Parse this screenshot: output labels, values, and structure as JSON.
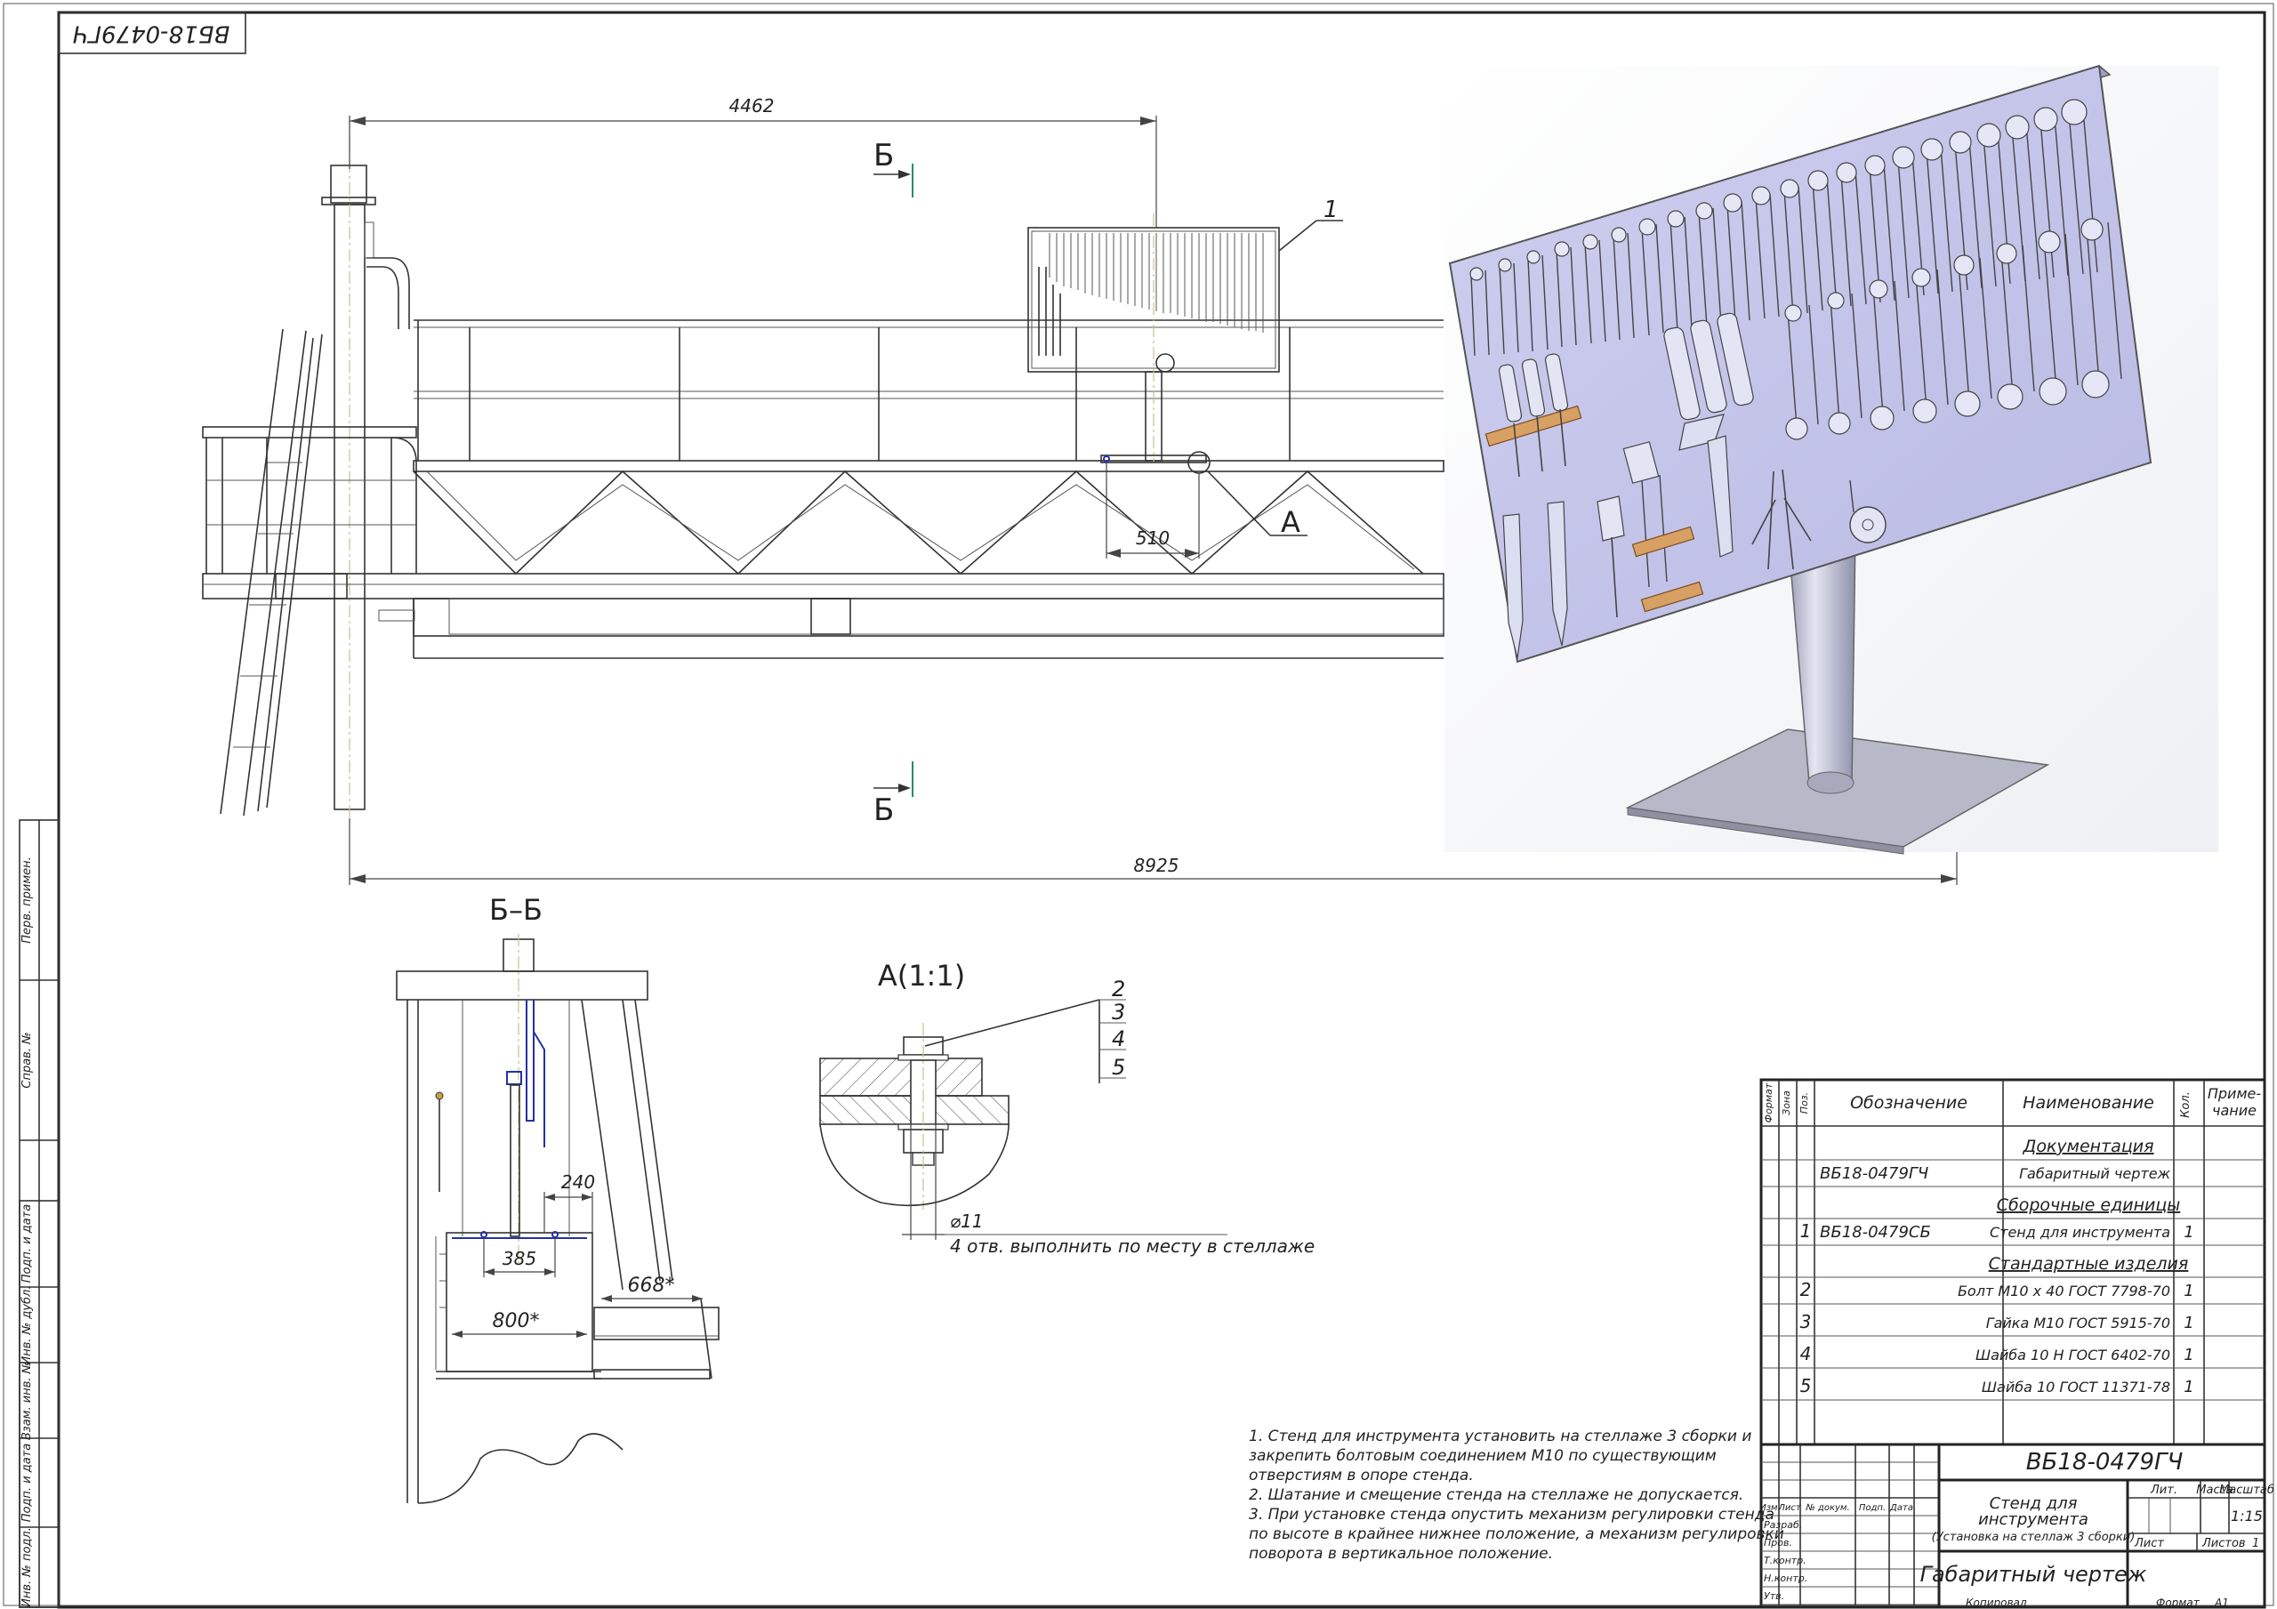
{
  "stamp_code_rotated": "ВБ18-0479ГЧ",
  "side_strip": [
    "Перв. примен.",
    "Справ. №",
    "Подп. и дата",
    "Инв. № дубл.",
    "Взам. инв. №",
    "Подп. и дата",
    "Инв. № подл."
  ],
  "dims": {
    "d4462": "4462",
    "d8925": "8925",
    "d510": "510",
    "d240": "240",
    "d385": "385",
    "d800": "800*",
    "d668": "668*",
    "d11": "⌀11"
  },
  "labels": {
    "sec_b_top": "Б",
    "sec_b_bottom": "Б",
    "section_title": "Б–Б",
    "callout_a": "А",
    "detail_title": "А(1:1)",
    "pos1": "1",
    "pos2": "2",
    "pos3": "3",
    "pos4": "4",
    "pos5": "5",
    "hole_note": "4 отв. выполнить по месту в стеллаже"
  },
  "notes": [
    "1. Стенд для инструмента установить на стеллаже 3 сборки и",
    "закрепить болтовым соединением М10 по существующим",
    "отверстиям в опоре стенда.",
    "2. Шатание и смещение стенда на стеллаже не допускается.",
    "3. При установке стенда опустить механизм регулировки стенда",
    "по высоте в крайнее нижнее положение, а механизм регулировки",
    "поворота в вертикальное положение."
  ],
  "spec": {
    "headers": {
      "format": "Формат",
      "zone": "Зона",
      "pos": "Поз.",
      "designation": "Обозначение",
      "name": "Наименование",
      "qty": "Кол.",
      "note": "Приме-чание"
    },
    "rows": [
      {
        "pos": "",
        "designation": "",
        "name": "Документация",
        "qty": "",
        "section": true
      },
      {
        "pos": "",
        "designation": "ВБ18-0479ГЧ",
        "name": "Габаритный чертеж",
        "qty": "",
        "section": false
      },
      {
        "pos": "",
        "designation": "",
        "name": "Сборочные единицы",
        "qty": "",
        "section": true
      },
      {
        "pos": "1",
        "designation": "ВБ18-0479СБ",
        "name": "Стенд для инструмента",
        "qty": "1",
        "section": false
      },
      {
        "pos": "",
        "designation": "",
        "name": "Стандартные изделия",
        "qty": "",
        "section": true
      },
      {
        "pos": "2",
        "designation": "",
        "name": "Болт М10 х 40 ГОСТ 7798-70",
        "qty": "1",
        "section": false
      },
      {
        "pos": "3",
        "designation": "",
        "name": "Гайка М10 ГОСТ 5915-70",
        "qty": "1",
        "section": false
      },
      {
        "pos": "4",
        "designation": "",
        "name": "Шайба 10 Н ГОСТ 6402-70",
        "qty": "1",
        "section": false
      },
      {
        "pos": "5",
        "designation": "",
        "name": "Шайба 10 ГОСТ 11371-78",
        "qty": "1",
        "section": false
      }
    ]
  },
  "title_block": {
    "code": "ВБ18-0479ГЧ",
    "name_1": "Стенд для",
    "name_2": "инструмента",
    "name_3": "(Установка на стеллаж 3 сборки)",
    "doc_type": "Габаритный чертеж",
    "col_izm": "Изм.",
    "col_list": "Лист",
    "col_docnum": "№ докум.",
    "col_podp": "Подп.",
    "col_data": "Дата",
    "razrab": "Разраб.",
    "prov": "Пров.",
    "tkontr": "Т.контр.",
    "nkontr": "Н.контр.",
    "utv": "Утв.",
    "lit": "Лит.",
    "massa": "Масса",
    "masshtab": "Масштаб",
    "scale": "1:15",
    "sheet_label": "Лист",
    "sheets_label": "Листов",
    "sheets": "1",
    "kopiroval": "Копировал",
    "format_label": "Формат",
    "format": "А1"
  }
}
